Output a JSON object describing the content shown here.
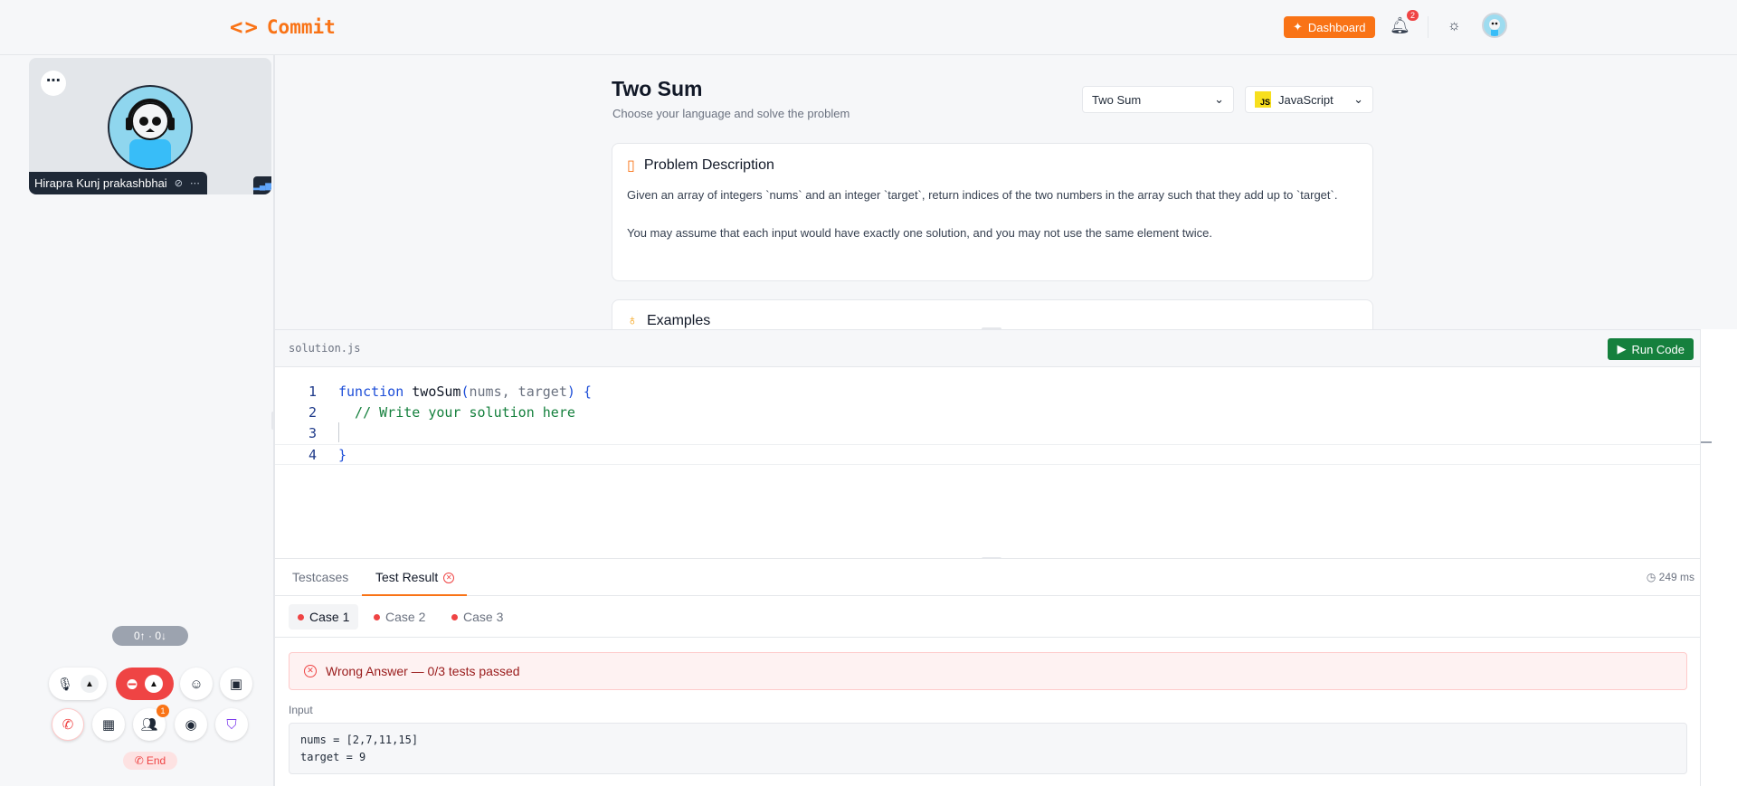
{
  "header": {
    "logo_text": "Commit",
    "dashboard_label": "Dashboard",
    "notification_count": "2"
  },
  "call": {
    "participant_name": "Hirapra Kunj prakashbhai",
    "stats": "0↑ · 0↓",
    "participants_badge": "1",
    "end_label": "End"
  },
  "problem": {
    "title": "Two Sum",
    "subtitle": "Choose your language and solve the problem",
    "problem_select": "Two Sum",
    "language_select": "JavaScript",
    "description_heading": "Problem Description",
    "description_p1": "Given an array of integers `nums` and an integer `target`, return indices of the two numbers in the array such that they add up to `target`.",
    "description_p2": "You may assume that each input would have exactly one solution, and you may not use the same element twice.",
    "examples_heading": "Examples"
  },
  "editor": {
    "filename": "solution.js",
    "run_label": "Run Code",
    "line_numbers": [
      "1",
      "2",
      "3",
      "4"
    ],
    "code": {
      "l1_kw": "function",
      "l1_fn": " twoSum",
      "l1_open": "(",
      "l1_params": "nums, target",
      "l1_close": ") {",
      "l2_comment": "  // Write your solution here",
      "l4_brace": "}"
    }
  },
  "results": {
    "tab_testcases": "Testcases",
    "tab_result": "Test Result",
    "timing": "249 ms",
    "cases": [
      "Case 1",
      "Case 2",
      "Case 3"
    ],
    "verdict": "Wrong Answer — 0/3 tests passed",
    "input_label": "Input",
    "input_value": "nums = [2,7,11,15]\ntarget = 9"
  },
  "colors": {
    "accent": "#f97316",
    "run": "#15803d",
    "error": "#ef4444"
  }
}
